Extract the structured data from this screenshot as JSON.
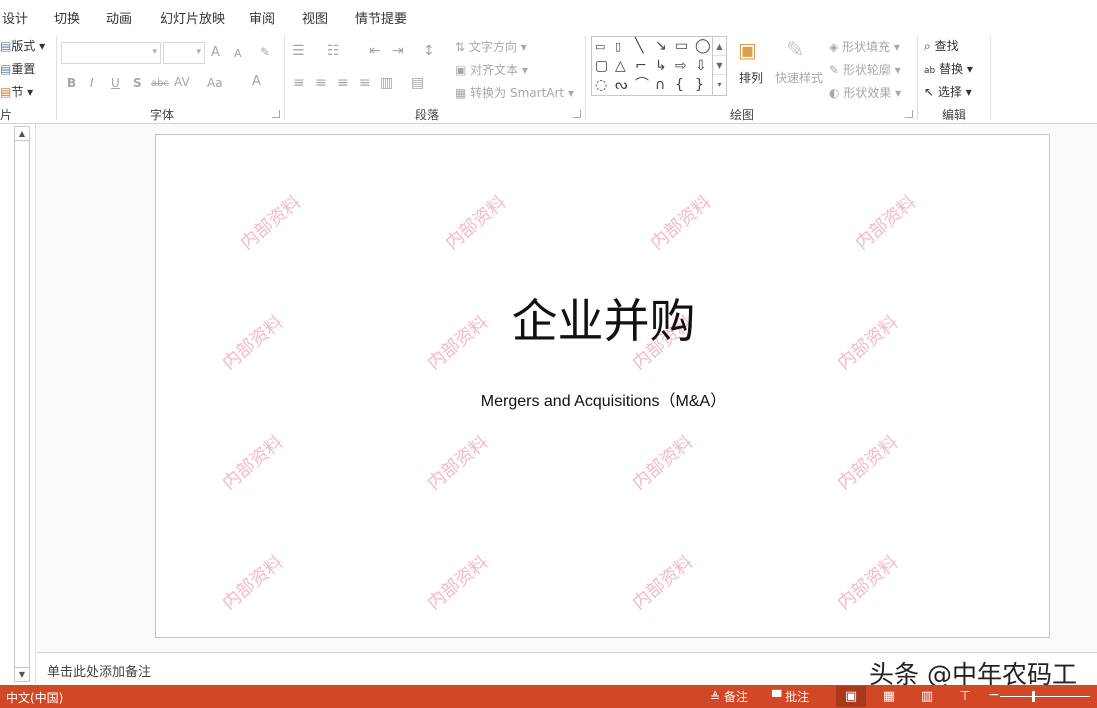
{
  "menu": {
    "tabs": [
      "设计",
      "切换",
      "动画",
      "幻灯片放映",
      "审阅",
      "视图",
      "情节提要"
    ]
  },
  "ribbon": {
    "slides": {
      "layout": "版式",
      "reset": "重置",
      "section": "节",
      "group_label": "片"
    },
    "font": {
      "group_label": "字体",
      "clear_format": "A",
      "bold": "B",
      "italic": "I",
      "underline": "U",
      "shadow": "S",
      "strike": "abc",
      "spacing": "AV",
      "case": "Aa",
      "color": "A",
      "grow": "A",
      "shrink": "A"
    },
    "paragraph": {
      "group_label": "段落",
      "text_direction": "文字方向",
      "align_text": "对齐文本",
      "smartart": "转换为 SmartArt"
    },
    "drawing": {
      "group_label": "绘图",
      "arrange": "排列",
      "quick_styles": "快速样式",
      "shape_fill": "形状填充",
      "shape_outline": "形状轮廓",
      "shape_effects": "形状效果"
    },
    "editing": {
      "group_label": "编辑",
      "find": "查找",
      "replace": "替换",
      "select": "选择"
    }
  },
  "slide": {
    "title": "企业并购",
    "subtitle": "Mergers and Acquisitions（M&A）",
    "watermark_text": "内部资料"
  },
  "notes": {
    "placeholder": "单击此处添加备注",
    "attribution": "头条 @中年农码工"
  },
  "status": {
    "language": "中文(中国)",
    "notes_label": "备注",
    "comments_label": "批注"
  },
  "colors": {
    "status_bar": "#d24726",
    "watermark": "#f4b8cd"
  }
}
